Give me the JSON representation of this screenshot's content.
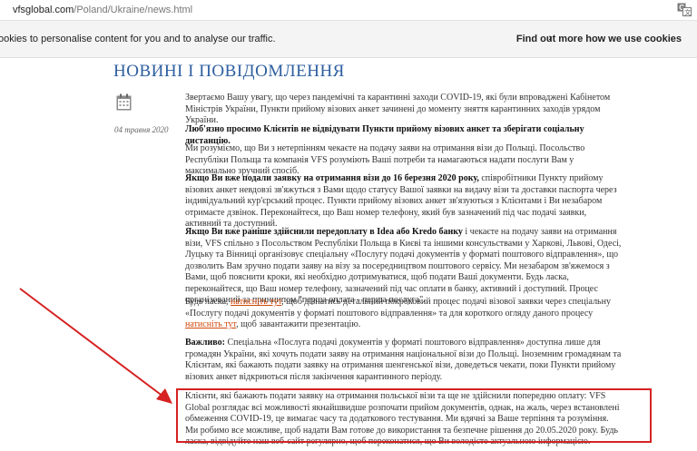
{
  "browser": {
    "url_domain": "vfsglobal.com",
    "url_path": "/Poland/Ukraine/news.html"
  },
  "cookie_bar": {
    "message": "ookies to personalise content for you and to analyse our traffic.",
    "more_chevron": "›",
    "more_link": "Find out more how we use cookies"
  },
  "page": {
    "title": "НОВИНІ І ПОВІДОМЛЕННЯ",
    "date": "04 травня 2020"
  },
  "article": {
    "p1": "Звертаємо Вашу увагу, що через пандемічні та карантинні заходи COVID-19, які були впроваджені Кабінетом Міністрів України, Пункти прийому візових анкет зачинені до моменту зняття карантинних заходів урядом України.",
    "p2": "Люб'язно просимо Клієнтів не відвідувати Пункти прийому візових анкет та зберігати соціальну дистанцію.",
    "p3": "Ми розуміємо, що Ви з нетерпінням чекаєте на подачу заяви на отримання візи до Польщі. Посольство Республіки Польща та компанія VFS розуміють Ваші потреби та намагаються надати послуги Вам у максимально зручний спосіб.",
    "p4_bold": "Якщо Ви вже подали заявку на отримання візи до 16 березня 2020 року,",
    "p4_rest": " співробітники Пункту прийому візових анкет невдовзі зв'яжуться з Вами щодо статусу Вашої заявки на видачу візи та доставки паспорта через індивідуальний кур'єрський процес. Пункти прийому візових анкет зв'язуються з Клієнтами і Ви незабаром отримаєте дзвінок. Переконайтеся, що Ваш номер телефону, який був зазначений під час подачі заявки, активний та доступний.",
    "p5_bold": "Якщо Ви вже раніше здійснили передоплату в Idea або Kredo банку",
    "p5_rest": " і чекаєте на подачу заяви на отримання візи, VFS спільно з Посольством Республіки Польща в Києві та іншими консульствами у Харкові, Львові, Одесі, Луцьку та Вінниці організовує спеціальну «Послугу подачі документів у форматі поштового відправлення», що дозволить Вам зручно подати заяву на візу за посередництвом поштового сервісу. Ми незабаром зв'яжемося з Вами, щоб пояснити кроки, які необхідно дотримуватися, щоб подати Ваші документи. Будь ласка, переконайтеся, що Ваш номер телефону, зазначений під час оплати в банку, активний і доступний. Процес організований за принципом \"перша оплата - перша послуга\".",
    "p6_a": "Будь ласка, ",
    "p6_link1": "натисніть тут",
    "p6_b": ", щоб дізнатись детальний покроковий процес подачі візової заявки через спеціальну «Послугу подачі документів у форматі поштового відправлення» та для короткого огляду даного процесу ",
    "p6_link2": "натисніть тут",
    "p6_c": ", щоб завантажити презентацію.",
    "p7_bold": "Важливо:",
    "p7_rest": " Спеціальна «Послуга подачі документів у форматі поштового відправлення» доступна лише для громадян України, які хочуть подати заяву на отримання національної візи до Польщі. Іноземним громадянам та Клієнтам, які бажають подати заявку на отримання шенгенської візи, доведеться чекати, поки Пункти прийому візових анкет відкриються після закінчення карантинного періоду.",
    "p8": "Клієнти, які бажають подати заявку на отримання польської візи та ще не здійснили попередню оплату: VFS Global розглядає всі можливості якнайшвидше розпочати прийом документів, однак, на жаль, через встановлені обмеження COVID-19, це вимагає часу та додаткового тестування. Ми вдячні за Ваше терпіння та розуміння. Ми робимо все можливе, щоб надати Вам готове до використання та безпечне рішення до 20.05.2020 року. Будь ласка, відвідуйте наш веб-сайт регулярно, щоб переконатися, що Ви володієте актуальною інформацією."
  },
  "colors": {
    "title": "#2d5fa0",
    "link": "#d0490d",
    "annotation": "#d62222"
  },
  "icons": [
    "translate-icon",
    "calendar-icon",
    "annotation-arrow"
  ]
}
